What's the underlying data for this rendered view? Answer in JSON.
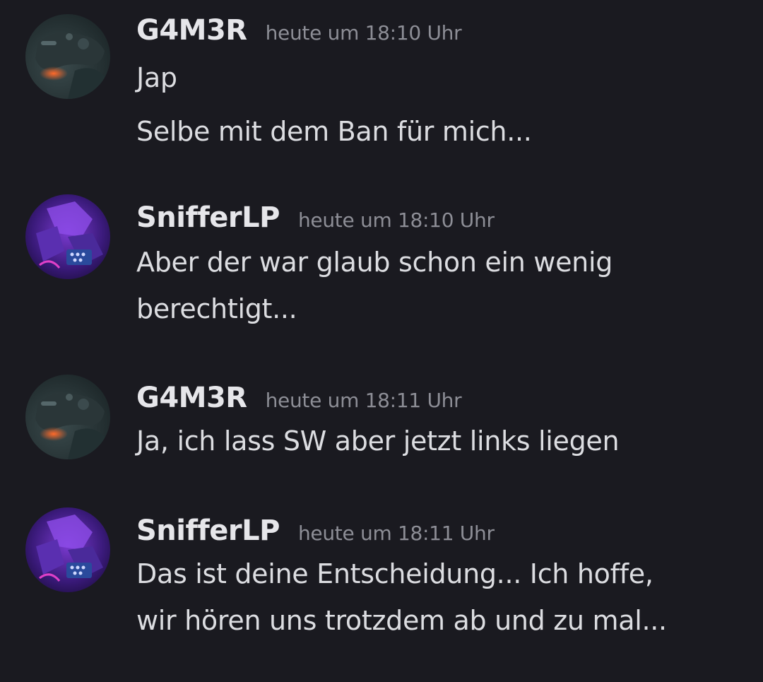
{
  "messages": [
    {
      "author": "G4M3R",
      "timestamp": "heute um 18:10 Uhr",
      "avatar_icon": "gamepad-avatar-icon",
      "lines": [
        "Jap",
        "Selbe mit dem Ban für mich..."
      ]
    },
    {
      "author": "SnifferLP",
      "timestamp": "heute um 18:10 Uhr",
      "avatar_icon": "purple-artwork-avatar-icon",
      "lines": [
        "Aber der war glaub schon ein wenig",
        "berechtigt..."
      ]
    },
    {
      "author": "G4M3R",
      "timestamp": "heute um 18:11 Uhr",
      "avatar_icon": "gamepad-avatar-icon",
      "lines": [
        "Ja, ich lass SW aber jetzt links liegen"
      ]
    },
    {
      "author": "SnifferLP",
      "timestamp": "heute um 18:11 Uhr",
      "avatar_icon": "purple-artwork-avatar-icon",
      "lines": [
        "Das ist deine Entscheidung... Ich hoffe,",
        "wir hören uns trotzdem ab und zu mal..."
      ]
    }
  ],
  "colors": {
    "background": "#1a1a20",
    "username": "#e6e6ea",
    "timestamp": "#8d8e96",
    "message_text": "#dcdde1"
  }
}
